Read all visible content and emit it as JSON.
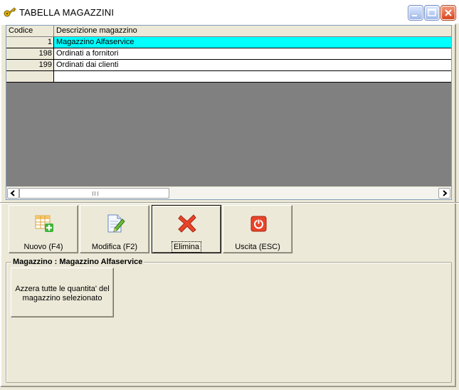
{
  "window": {
    "title": "TABELLA MAGAZZINI",
    "icon": "key-icon"
  },
  "grid": {
    "columns": [
      "Codice",
      "Descrizione magazzino"
    ],
    "rows": [
      {
        "code": "1",
        "description": "Magazzino Alfaservice",
        "selected": true
      },
      {
        "code": "198",
        "description": "Ordinati a fornitori",
        "selected": false
      },
      {
        "code": "199",
        "description": "Ordinati dai clienti",
        "selected": false
      },
      {
        "code": "",
        "description": "",
        "selected": false
      }
    ],
    "selection_color": "#00ffff"
  },
  "toolbar": {
    "new_label": "Nuovo (F4)",
    "edit_label": "Modifica (F2)",
    "delete_label": "Elimina",
    "exit_label": "Uscita (ESC)"
  },
  "group": {
    "title": "Magazzino : Magazzino Alfaservice",
    "reset_label_line1": "Azzera tutte le quantita' del",
    "reset_label_line2": "magazzino selezionato"
  }
}
